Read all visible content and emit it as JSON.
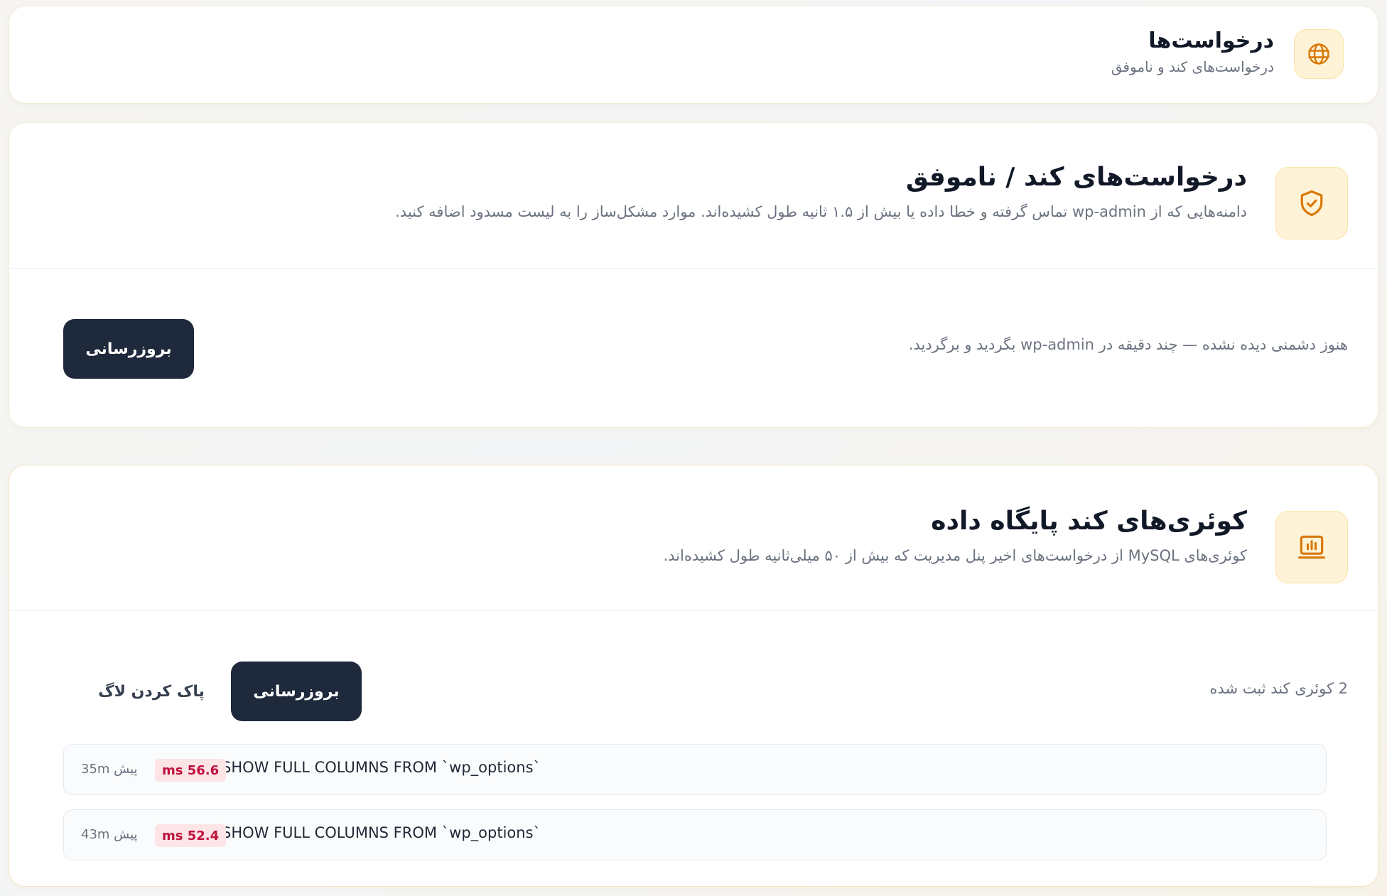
{
  "header": {
    "title": "درخواست‌ها",
    "subtitle": "درخواست‌های کند و ناموفق",
    "icon": "globe-icon"
  },
  "slow_requests": {
    "title": "درخواست‌های کند / ناموفق",
    "description": "دامنه‌هایی که از wp-admin تماس گرفته و خطا داده یا بیش از ۱.۵ ثانیه طول کشیده‌اند. موارد مشکل‌ساز را به لیست مسدود اضافه کنید.",
    "icon": "shield-check-icon",
    "empty_message": "هنوز دشمنی دیده نشده — چند دقیقه در wp-admin بگردید و برگردید.",
    "refresh_label": "بروزرسانی"
  },
  "slow_queries": {
    "title": "کوئری‌های کند پایگاه داده",
    "description": "کوئری‌های MySQL از درخواست‌های اخیر پنل مدیریت که بیش از ۵۰ میلی‌ثانیه طول کشیده‌اند.",
    "icon": "bar-chart-icon",
    "count_label": "2 کوئری کند ثبت شده",
    "refresh_label": "بروزرسانی",
    "clear_label": "پاک کردن لاگ",
    "queries": [
      {
        "sql": "SHOW FULL COLUMNS FROM `wp_options`",
        "duration": "ms 56.6",
        "ago": "35m پیش"
      },
      {
        "sql": "SHOW FULL COLUMNS FROM `wp_options`",
        "duration": "ms 52.4",
        "ago": "43m پیش"
      }
    ]
  },
  "colors": {
    "accent": "#d97706",
    "accent_bg": "#fef3d6",
    "button_dark": "#1e293b",
    "badge_bg": "#fde4e7",
    "badge_text": "#be123c"
  }
}
